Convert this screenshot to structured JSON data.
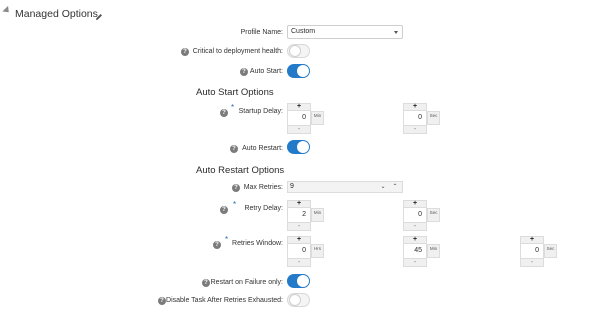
{
  "header": {
    "title": "Managed Options",
    "edit_icon": "pencil-icon"
  },
  "profile": {
    "label": "Profile Name:",
    "value": "Custom"
  },
  "critical": {
    "label": "Critical to deployment health:",
    "on": false
  },
  "auto_start": {
    "label": "Auto Start:",
    "on": true
  },
  "auto_start_options": {
    "heading": "Auto Start Options",
    "startup_delay": {
      "label": "Startup Delay:",
      "min": "0",
      "min_unit": "Min",
      "sec": "0",
      "sec_unit": "Sec"
    },
    "auto_restart": {
      "label": "Auto Restart:",
      "on": true
    }
  },
  "auto_restart_options": {
    "heading": "Auto Restart Options",
    "max_retries": {
      "label": "Max Retries:",
      "value": "9"
    },
    "retry_delay": {
      "label": "Retry Delay:",
      "min": "2",
      "min_unit": "Min",
      "sec": "0",
      "sec_unit": "Sec"
    },
    "retries_window": {
      "label": "Retries Window:",
      "hrs": "0",
      "hrs_unit": "Hrs",
      "min": "45",
      "min_unit": "Min",
      "sec": "0",
      "sec_unit": "Sec"
    }
  },
  "restart_on_failure": {
    "label": "Restart on Failure only:",
    "on": true
  },
  "disable_task": {
    "label": "Disable Task After Retries Exhausted:",
    "on": false
  },
  "spinner": {
    "plus": "+",
    "minus": "-"
  },
  "colors": {
    "toggle_on": "#227ac9",
    "toggle_off": "#f4f4f4",
    "required_marker": "#2b6cb0"
  }
}
